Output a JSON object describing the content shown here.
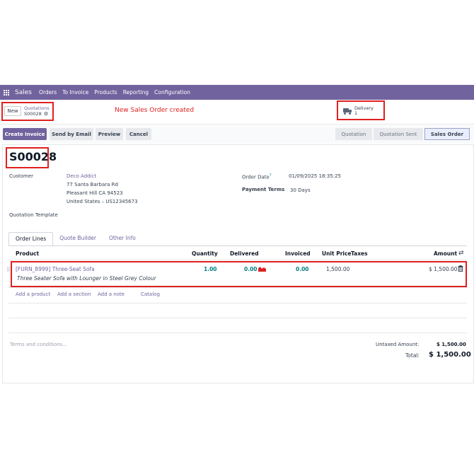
{
  "navbar": {
    "brand": "Sales",
    "items": [
      "Orders",
      "To Invoice",
      "Products",
      "Reporting",
      "Configuration"
    ]
  },
  "control": {
    "new_label": "New",
    "breadcrumb_root": "Quotations",
    "breadcrumb_current": "S00028",
    "annotation": "New Sales Order created",
    "delivery_label": "Delivery",
    "delivery_count": "1"
  },
  "actions": {
    "create_invoice": "Create Invoice",
    "send_email": "Send by Email",
    "preview": "Preview",
    "cancel": "Cancel"
  },
  "statusbar": [
    "Quotation",
    "Quotation Sent",
    "Sales Order"
  ],
  "order": {
    "name": "S00028",
    "customer_label": "Customer",
    "customer_name": "Deco Addict",
    "address_1": "77 Santa Barbara Rd",
    "address_2": "Pleasant Hill CA 94523",
    "address_3": "United States – US12345673",
    "order_date_label": "Order Date",
    "order_date_help": "?",
    "order_date": "01/09/2025 18:35:25",
    "payment_terms_label": "Payment Terms",
    "payment_terms": "30 Days",
    "template_label": "Quotation Template"
  },
  "tabs": [
    "Order Lines",
    "Quote Builder",
    "Other Info"
  ],
  "table": {
    "headers": {
      "product": "Product",
      "quantity": "Quantity",
      "delivered": "Delivered",
      "invoiced": "Invoiced",
      "unit_price": "Unit Price",
      "taxes": "Taxes",
      "amount": "Amount"
    },
    "line": {
      "product": "[FURN_8999] Three-Seat Sofa",
      "description": "Three Seater Sofa with Lounger in Steel Grey Colour",
      "quantity": "1.00",
      "delivered": "0.00",
      "invoiced": "0.00",
      "unit_price": "1,500.00",
      "amount": "$ 1,500.00"
    },
    "add_links": [
      "Add a product",
      "Add a section",
      "Add a note",
      "Catalog"
    ]
  },
  "footer": {
    "terms_placeholder": "Terms and conditions...",
    "untaxed_label": "Untaxed Amount:",
    "untaxed_value": "$ 1,500.00",
    "total_label": "Total:",
    "total_value": "$ 1,500.00"
  },
  "colors": {
    "brand": "#71639e",
    "link": "#017e84",
    "annotation": "#e02020"
  }
}
